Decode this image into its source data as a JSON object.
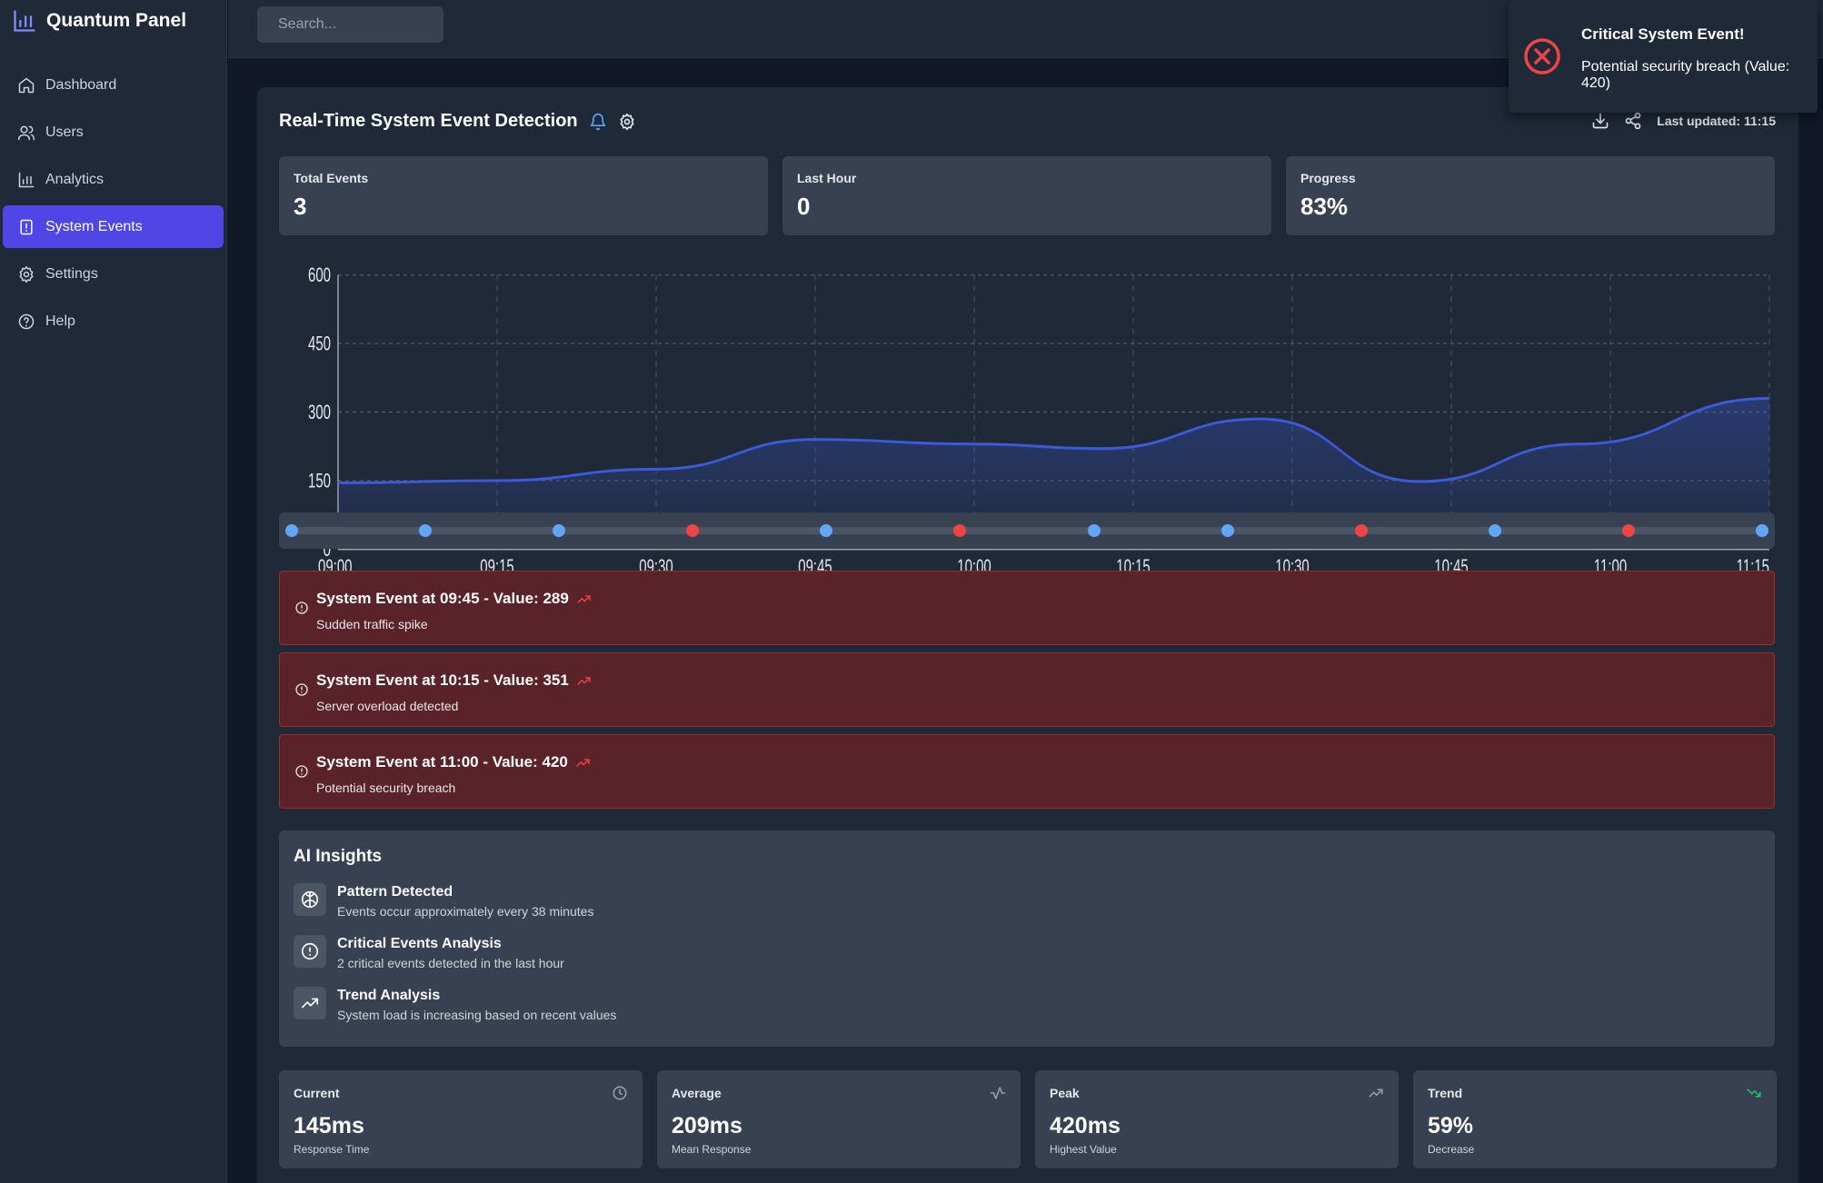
{
  "app": {
    "name": "Quantum Panel"
  },
  "sidebar": {
    "items": [
      {
        "label": "Dashboard",
        "icon": "home-icon",
        "active": false
      },
      {
        "label": "Users",
        "icon": "users-icon",
        "active": false
      },
      {
        "label": "Analytics",
        "icon": "bar-chart-icon",
        "active": false
      },
      {
        "label": "System Events",
        "icon": "alert-file-icon",
        "active": true
      },
      {
        "label": "Settings",
        "icon": "gear-icon",
        "active": false
      },
      {
        "label": "Help",
        "icon": "help-circle-icon",
        "active": false
      }
    ]
  },
  "search": {
    "placeholder": "Search..."
  },
  "panel": {
    "title": "Real-Time System Event Detection",
    "last_updated": "Last updated: 11:15"
  },
  "stats": [
    {
      "label": "Total Events",
      "value": "3"
    },
    {
      "label": "Last Hour",
      "value": "0"
    },
    {
      "label": "Progress",
      "value": "83%"
    }
  ],
  "chart_data": {
    "type": "area",
    "x": [
      "09:00",
      "09:15",
      "09:30",
      "09:45",
      "10:00",
      "10:15",
      "10:30",
      "10:45",
      "11:00",
      "11:15"
    ],
    "yticks": [
      "0",
      "150",
      "300",
      "450",
      "600"
    ],
    "ylim": [
      0,
      600
    ],
    "points": [
      {
        "t": 0,
        "v": 145
      },
      {
        "t": 25,
        "v": 150
      },
      {
        "t": 50,
        "v": 175
      },
      {
        "t": 75,
        "v": 240
      },
      {
        "t": 100,
        "v": 230
      },
      {
        "t": 120,
        "v": 220
      },
      {
        "t": 145,
        "v": 285
      },
      {
        "t": 170,
        "v": 148
      },
      {
        "t": 195,
        "v": 230
      },
      {
        "t": 225,
        "v": 330
      }
    ],
    "grid": true,
    "color": "#3b5bdb"
  },
  "timeline": {
    "dots": [
      {
        "pos": 0,
        "color": "#60a5fa"
      },
      {
        "pos": 9.09,
        "color": "#60a5fa"
      },
      {
        "pos": 18.18,
        "color": "#60a5fa"
      },
      {
        "pos": 27.27,
        "color": "#ef4444"
      },
      {
        "pos": 36.36,
        "color": "#60a5fa"
      },
      {
        "pos": 45.45,
        "color": "#ef4444"
      },
      {
        "pos": 54.55,
        "color": "#60a5fa"
      },
      {
        "pos": 63.64,
        "color": "#60a5fa"
      },
      {
        "pos": 72.73,
        "color": "#ef4444"
      },
      {
        "pos": 81.82,
        "color": "#60a5fa"
      },
      {
        "pos": 90.91,
        "color": "#ef4444"
      },
      {
        "pos": 100,
        "color": "#60a5fa"
      }
    ]
  },
  "events": [
    {
      "title": "System Event at 09:45 - Value: 289",
      "desc": "Sudden traffic spike"
    },
    {
      "title": "System Event at 10:15 - Value: 351",
      "desc": "Server overload detected"
    },
    {
      "title": "System Event at 11:00 - Value: 420",
      "desc": "Potential security breach"
    }
  ],
  "insights": {
    "title": "AI Insights",
    "items": [
      {
        "title": "Pattern Detected",
        "desc": "Events occur approximately every 38 minutes",
        "icon": "brain-icon"
      },
      {
        "title": "Critical Events Analysis",
        "desc": "2 critical events detected in the last hour",
        "icon": "alert-circle-icon"
      },
      {
        "title": "Trend Analysis",
        "desc": "System load is increasing based on recent values",
        "icon": "trending-up-icon"
      }
    ]
  },
  "metrics": [
    {
      "label": "Current",
      "value": "145ms",
      "sub": "Response Time",
      "icon": "clock-icon"
    },
    {
      "label": "Average",
      "value": "209ms",
      "sub": "Mean Response",
      "icon": "activity-icon"
    },
    {
      "label": "Peak",
      "value": "420ms",
      "sub": "Highest Value",
      "icon": "trending-up-icon"
    },
    {
      "label": "Trend",
      "value": "59%",
      "sub": "Decrease",
      "icon": "trending-down-icon"
    }
  ],
  "toast": {
    "title": "Critical System Event!",
    "message": "Potential security breach (Value: 420)"
  },
  "colors": {
    "accent": "#4f46e5",
    "critical": "#ef4444",
    "info": "#60a5fa",
    "trend_down": "#22c55e"
  }
}
